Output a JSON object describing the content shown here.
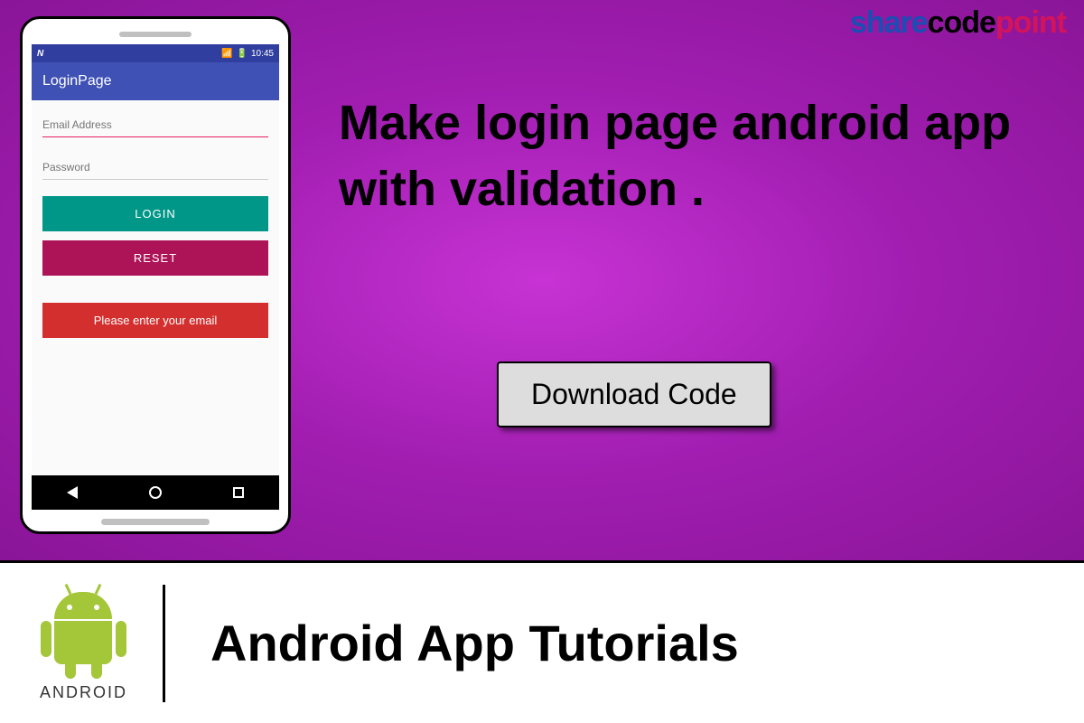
{
  "logo": {
    "part1": "share",
    "part2": "code",
    "part3": "point"
  },
  "phone": {
    "status_time": "10:45",
    "status_n": "N",
    "app_title": "LoginPage",
    "inputs": {
      "email_placeholder": "Email Address",
      "password_placeholder": "Password"
    },
    "buttons": {
      "login": "LOGIN",
      "reset": "RESET"
    },
    "error_message": "Please enter your email"
  },
  "headline": "Make login page android app with  validation .",
  "download_button": "Download Code",
  "footer": {
    "android_label": "ANDROID",
    "tutorials_title": "Android App Tutorials"
  }
}
